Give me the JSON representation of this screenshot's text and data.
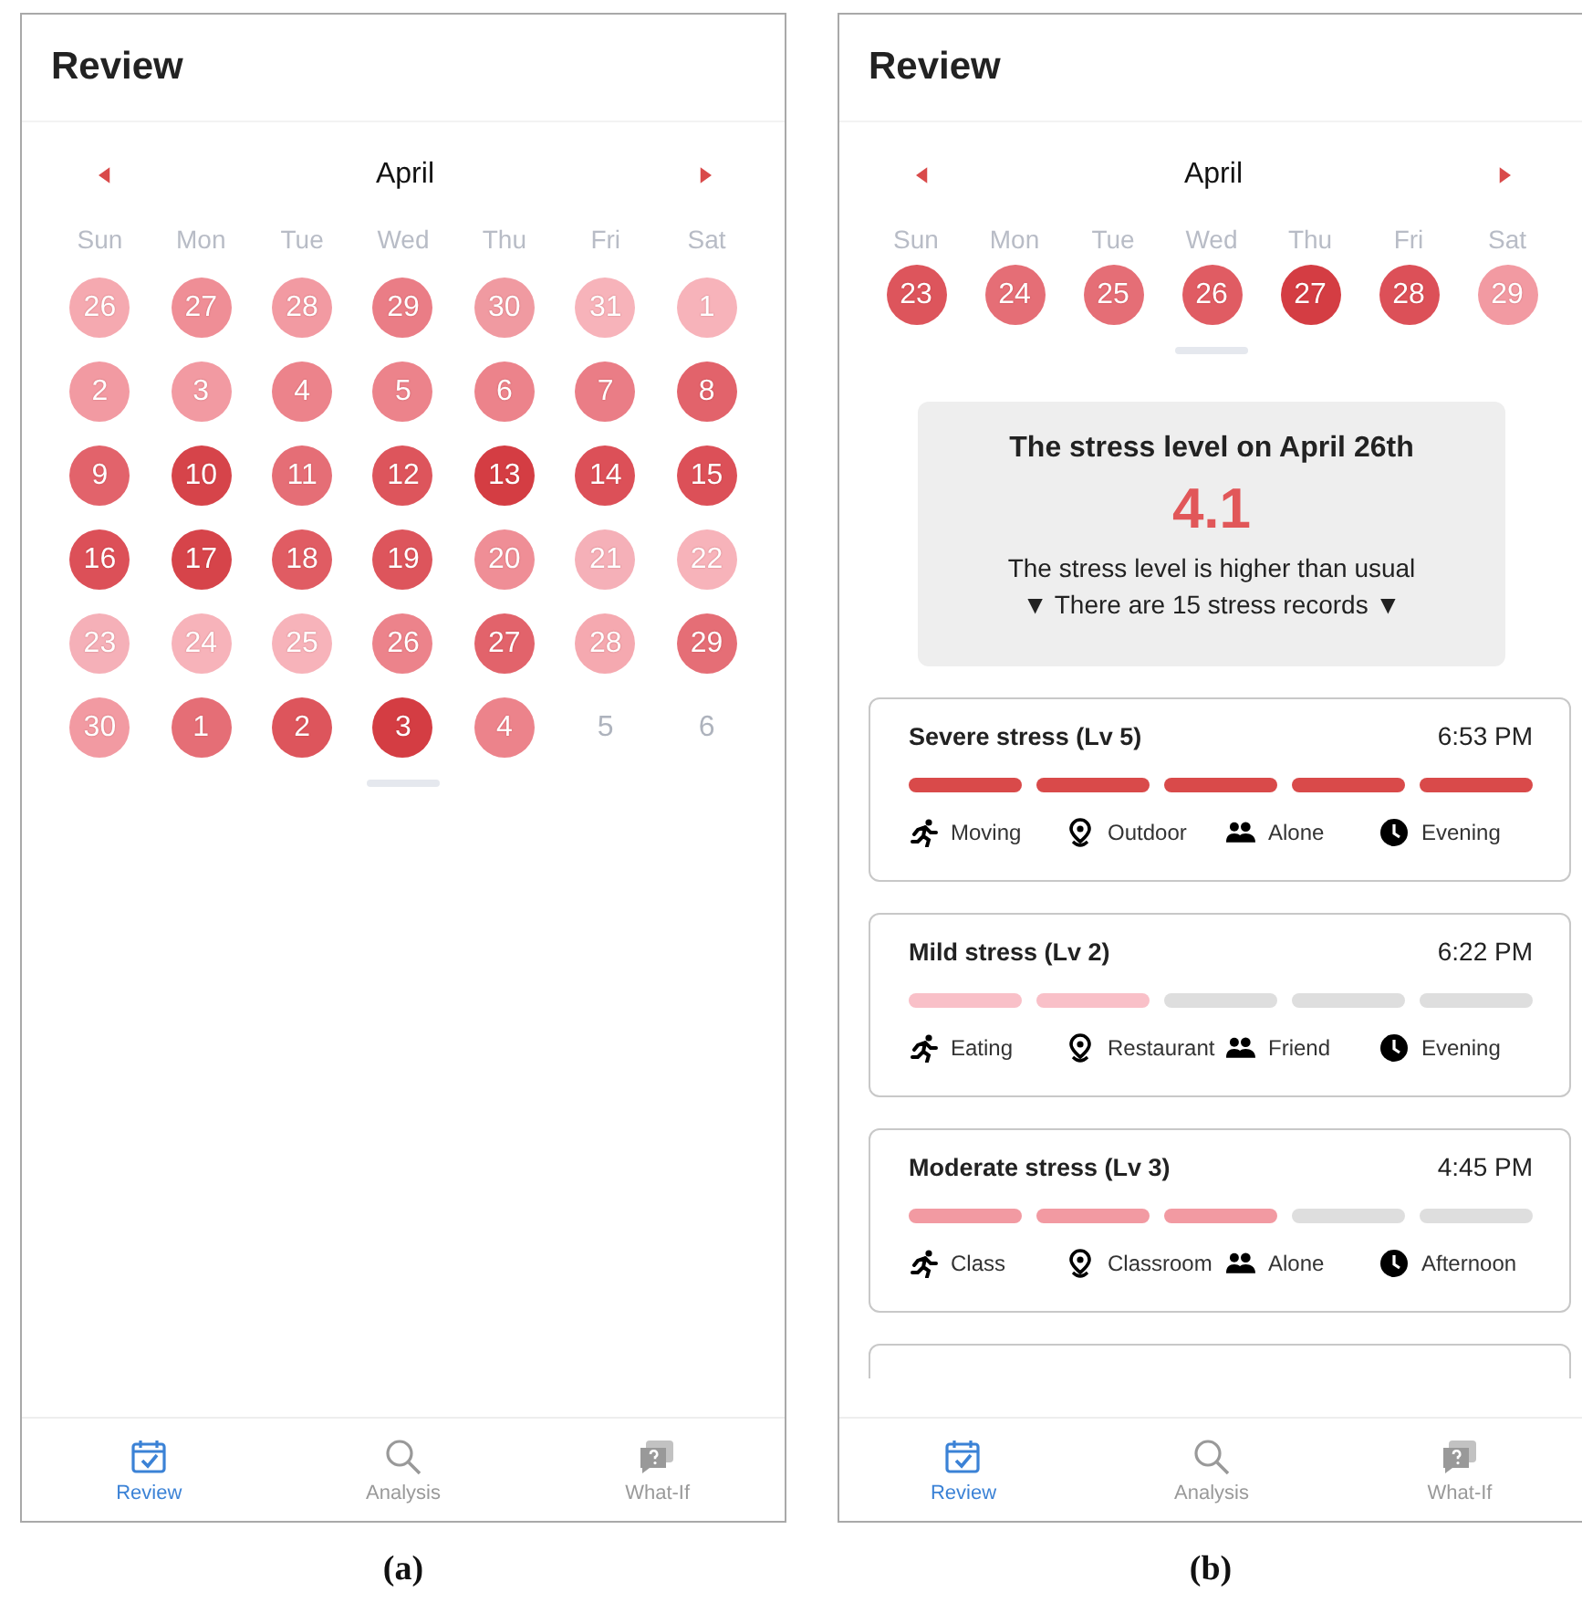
{
  "panels": [
    {
      "caption": "(a)",
      "title": "Review",
      "month": "April",
      "weekdays": [
        "Sun",
        "Mon",
        "Tue",
        "Wed",
        "Thu",
        "Fri",
        "Sat"
      ],
      "days": [
        {
          "label": "26",
          "color": "#f5a9b0"
        },
        {
          "label": "27",
          "color": "#ef8e96"
        },
        {
          "label": "28",
          "color": "#f29aa2"
        },
        {
          "label": "29",
          "color": "#ea7d86"
        },
        {
          "label": "30",
          "color": "#f09aa1"
        },
        {
          "label": "31",
          "color": "#f7b3ba"
        },
        {
          "label": "1",
          "color": "#f7b3ba"
        },
        {
          "label": "2",
          "color": "#f29aa2"
        },
        {
          "label": "3",
          "color": "#f29aa2"
        },
        {
          "label": "4",
          "color": "#ec838b"
        },
        {
          "label": "5",
          "color": "#ec838b"
        },
        {
          "label": "6",
          "color": "#ec838b"
        },
        {
          "label": "7",
          "color": "#ea7d86"
        },
        {
          "label": "8",
          "color": "#e2636b"
        },
        {
          "label": "9",
          "color": "#e2636b"
        },
        {
          "label": "10",
          "color": "#d6444a"
        },
        {
          "label": "11",
          "color": "#e56e76"
        },
        {
          "label": "12",
          "color": "#dd555c"
        },
        {
          "label": "13",
          "color": "#d43d43"
        },
        {
          "label": "14",
          "color": "#dc5058"
        },
        {
          "label": "15",
          "color": "#dc5058"
        },
        {
          "label": "16",
          "color": "#dc5058"
        },
        {
          "label": "17",
          "color": "#d6444a"
        },
        {
          "label": "18",
          "color": "#e05c63"
        },
        {
          "label": "19",
          "color": "#dd555c"
        },
        {
          "label": "20",
          "color": "#ef8e96"
        },
        {
          "label": "21",
          "color": "#f5b0b8"
        },
        {
          "label": "22",
          "color": "#f7b3ba"
        },
        {
          "label": "23",
          "color": "#f5b0b8"
        },
        {
          "label": "24",
          "color": "#f7b3ba"
        },
        {
          "label": "25",
          "color": "#f7b3ba"
        },
        {
          "label": "26",
          "color": "#ec838b"
        },
        {
          "label": "27",
          "color": "#e2636b"
        },
        {
          "label": "28",
          "color": "#f5a9b0"
        },
        {
          "label": "29",
          "color": "#e56e76"
        },
        {
          "label": "30",
          "color": "#f29aa2"
        },
        {
          "label": "1",
          "color": "#e56e76"
        },
        {
          "label": "2",
          "color": "#dd555c"
        },
        {
          "label": "3",
          "color": "#d43d43"
        },
        {
          "label": "4",
          "color": "#ec838b"
        },
        {
          "label": "5",
          "kind": "blank"
        },
        {
          "label": "6",
          "kind": "blank"
        }
      ],
      "tabs": [
        {
          "label": "Review",
          "kind": "calendar",
          "selected": true
        },
        {
          "label": "Analysis",
          "kind": "search",
          "selected": false
        },
        {
          "label": "What-If",
          "kind": "question",
          "selected": false
        }
      ]
    },
    {
      "caption": "(b)",
      "title": "Review",
      "month": "April",
      "weekdays": [
        "Sun",
        "Mon",
        "Tue",
        "Wed",
        "Thu",
        "Fri",
        "Sat"
      ],
      "days": [
        {
          "label": "23",
          "color": "#dd555c"
        },
        {
          "label": "24",
          "color": "#e56e76"
        },
        {
          "label": "25",
          "color": "#e56e76"
        },
        {
          "label": "26",
          "color": "#e05c63"
        },
        {
          "label": "27",
          "color": "#d43d43"
        },
        {
          "label": "28",
          "color": "#dc5058"
        },
        {
          "label": "29",
          "color": "#f29aa2"
        }
      ],
      "summary": {
        "heading": "The stress level on April 26th",
        "score": "4.1",
        "note": "The stress level is higher than usual",
        "records_toggle": "▼ There are 15 stress records ▼"
      },
      "records": [
        {
          "title": "Severe stress (Lv 5)",
          "time": "6:53 PM",
          "color": "#d94a4a",
          "segments": [
            {
              "filled": true
            },
            {
              "filled": true
            },
            {
              "filled": true
            },
            {
              "filled": true
            },
            {
              "filled": true
            }
          ],
          "tags": [
            {
              "kind": "activity",
              "label": "Moving"
            },
            {
              "kind": "place",
              "label": "Outdoor"
            },
            {
              "kind": "company",
              "label": "Alone"
            },
            {
              "kind": "time",
              "label": "Evening"
            }
          ]
        },
        {
          "title": "Mild stress (Lv 2)",
          "time": "6:22 PM",
          "color": "#f9c0c8",
          "segments": [
            {
              "filled": true
            },
            {
              "filled": true
            },
            {
              "filled": false
            },
            {
              "filled": false
            },
            {
              "filled": false
            }
          ],
          "tags": [
            {
              "kind": "activity",
              "label": "Eating"
            },
            {
              "kind": "place",
              "label": "Restaurant"
            },
            {
              "kind": "company",
              "label": "Friend"
            },
            {
              "kind": "time",
              "label": "Evening"
            }
          ]
        },
        {
          "title": "Moderate stress (Lv 3)",
          "time": "4:45 PM",
          "color": "#f29aa2",
          "segments": [
            {
              "filled": true
            },
            {
              "filled": true
            },
            {
              "filled": true
            },
            {
              "filled": false
            },
            {
              "filled": false
            }
          ],
          "tags": [
            {
              "kind": "activity",
              "label": "Class"
            },
            {
              "kind": "place",
              "label": "Classroom"
            },
            {
              "kind": "company",
              "label": "Alone"
            },
            {
              "kind": "time",
              "label": "Afternoon"
            }
          ]
        }
      ],
      "more_records_below": true,
      "tabs": [
        {
          "label": "Review",
          "kind": "calendar",
          "selected": true
        },
        {
          "label": "Analysis",
          "kind": "search",
          "selected": false
        },
        {
          "label": "What-If",
          "kind": "question",
          "selected": false
        }
      ]
    }
  ]
}
